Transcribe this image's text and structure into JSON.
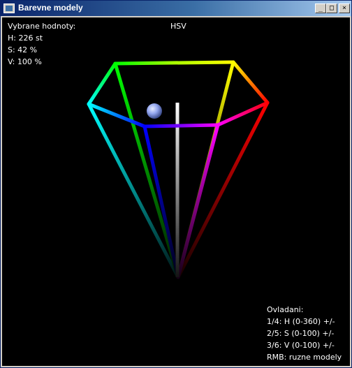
{
  "window": {
    "title": "Barevne modely",
    "minimize_symbol": "_",
    "maximize_symbol": "□",
    "close_symbol": "×"
  },
  "readout": {
    "heading": "Vybrane hodnoty:",
    "hue": "H: 226 st",
    "saturation": "S:  42 %",
    "value": "V: 100 %"
  },
  "model_label": "HSV",
  "controls": {
    "heading": "Ovladani:",
    "line1": "1/4: H (0-360) +/-",
    "line2": "2/5: S (0-100) +/-",
    "line3": "3/6: V (0-100) +/-",
    "line4": "RMB: ruzne modely"
  },
  "selection": {
    "hue_deg": 226,
    "saturation_pct": 42,
    "value_pct": 100,
    "marker_color": "#94a7f0"
  },
  "colors": {
    "background": "#000000",
    "text": "#ffffff"
  }
}
